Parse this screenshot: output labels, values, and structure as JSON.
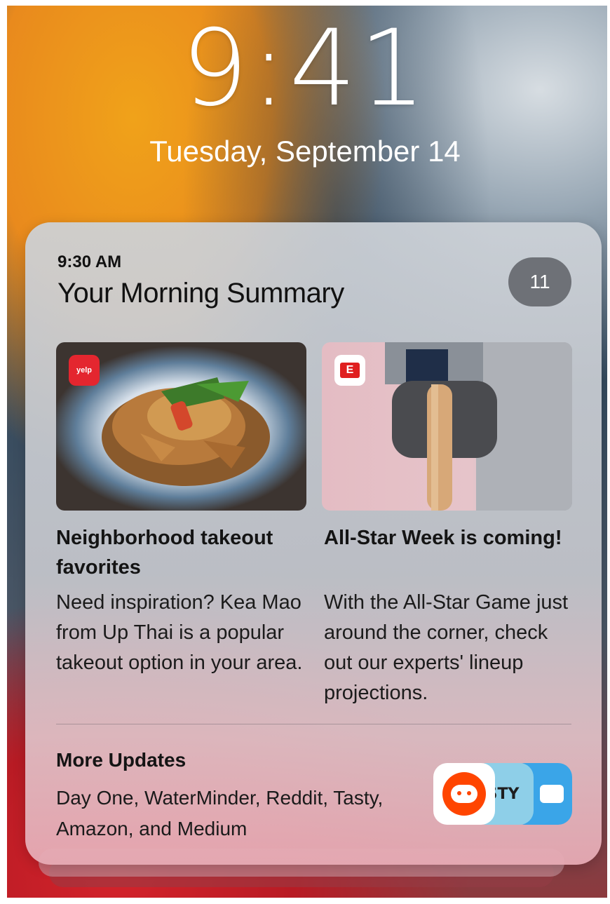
{
  "lockscreen": {
    "time": "9:41",
    "date": "Tuesday, September 14"
  },
  "summary": {
    "time": "9:30 AM",
    "title": "Your Morning Summary",
    "count": "11",
    "items": [
      {
        "app_badge": "yelp",
        "headline": "Neighborhood takeout favorites",
        "body": "Need inspiration? Kea Mao from Up Thai is a popular takeout option in your area."
      },
      {
        "app_badge": "E",
        "headline": "All-Star Week is coming!",
        "body": "With the All-Star Game just around the corner, check out our experts' lineup projections."
      }
    ],
    "more": {
      "title": "More Updates",
      "body": "Day One, WaterMinder, Reddit, Tasty, Amazon, and Medium",
      "tasty_label": "STY"
    }
  },
  "colors": {
    "yelp": "#e4262f",
    "espn": "#e02020",
    "reddit": "#ff4500",
    "blue_app": "#3aa5e8"
  },
  "icons": [
    "yelp-icon",
    "espn-icon",
    "reddit-icon",
    "tasty-icon",
    "message-icon"
  ]
}
